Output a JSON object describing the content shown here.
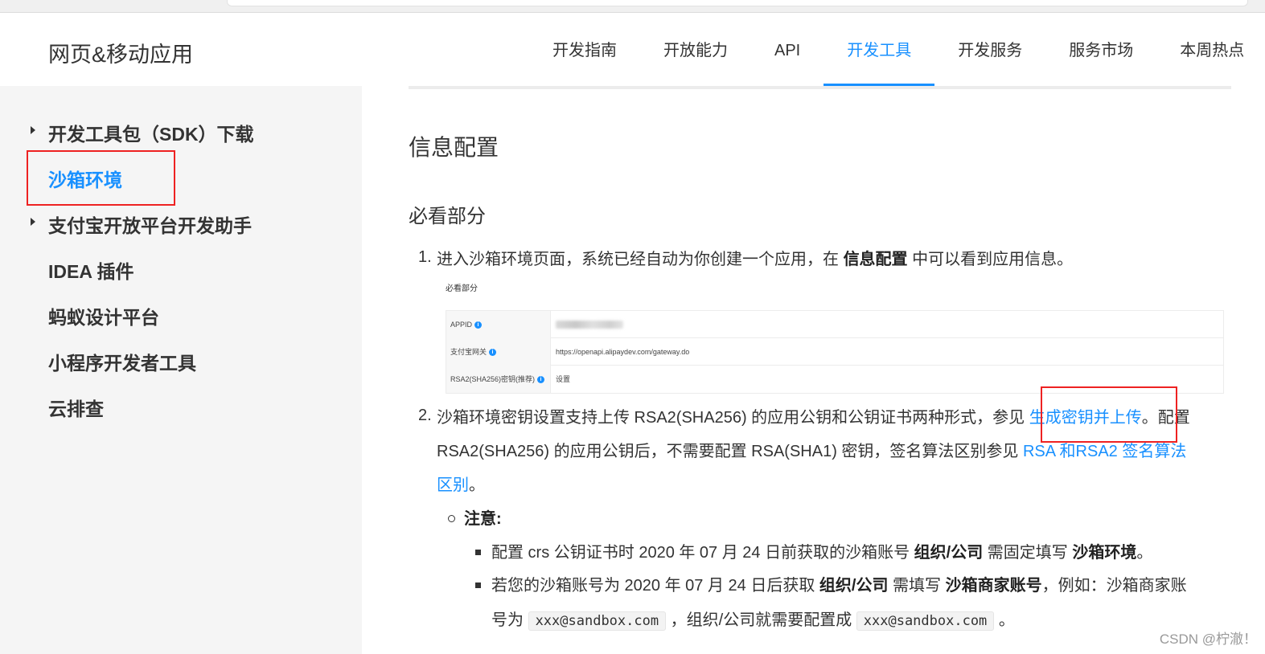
{
  "header": {
    "brand": "网页&移动应用",
    "nav": [
      {
        "label": "开发指南"
      },
      {
        "label": "开放能力"
      },
      {
        "label": "API"
      },
      {
        "label": "开发工具",
        "active": true
      },
      {
        "label": "开发服务"
      },
      {
        "label": "服务市场"
      },
      {
        "label": "本周热点"
      }
    ]
  },
  "sidebar": {
    "items": [
      {
        "label": "开发工具包（SDK）下载",
        "expandable": true
      },
      {
        "label": "沙箱环境",
        "active": true
      },
      {
        "label": "支付宝开放平台开发助手",
        "expandable": true
      },
      {
        "label": "IDEA 插件"
      },
      {
        "label": "蚂蚁设计平台"
      },
      {
        "label": "小程序开发者工具"
      },
      {
        "label": "云排查"
      }
    ]
  },
  "content": {
    "title": "信息配置",
    "section": "必看部分",
    "step1": {
      "num": "1.",
      "pre": "进入沙箱环境页面，系统已经自动为你创建一个应用，在 ",
      "bold": "信息配置",
      "post": " 中可以看到应用信息。"
    },
    "embedded": {
      "title": "必看部分",
      "rows": [
        {
          "label": "APPID",
          "value": ""
        },
        {
          "label": "支付宝网关",
          "value": "https://openapi.alipaydev.com/gateway.do"
        },
        {
          "label": "RSA2(SHA256)密钥(推荐)",
          "value": "设置"
        }
      ]
    },
    "step2": {
      "num": "2.",
      "line1_pre": "沙箱环境密钥设置支持上传 RSA2(SHA256) 的应用公钥和公钥证书两种形式，参见 ",
      "line1_link": "生成密钥并上传",
      "line1_post": "。配置",
      "line2_pre": "RSA2(SHA256) 的应用公钥后，不需要配置 RSA(SHA1) 密钥，签名算法区别参见 ",
      "line2_link": "RSA 和RSA2 签名算法",
      "line3_link": "区别",
      "line3_post": "。"
    },
    "note": {
      "label": "注意:",
      "item1": {
        "pre": "配置 crs 公钥证书时 2020 年 07 月 24 日前获取的沙箱账号 ",
        "bold1": "组织/公司",
        "mid": " 需固定填写 ",
        "bold2": "沙箱环境",
        "post": "。"
      },
      "item2": {
        "pre": "若您的沙箱账号为 2020 年 07 月 24 日后获取 ",
        "bold1": "组织/公司",
        "mid": " 需填写 ",
        "bold2": "沙箱商家账号",
        "post": "，例如：沙箱商家账",
        "line2_pre": "号为 ",
        "code1": "xxx@sandbox.com",
        "line2_mid": " ，组织/公司就需要配置成 ",
        "code2": "xxx@sandbox.com",
        "line2_post": " 。"
      }
    }
  },
  "watermark": "CSDN @柠澈！",
  "colors": {
    "accent": "#1890ff",
    "highlight_box": "#e22222"
  }
}
